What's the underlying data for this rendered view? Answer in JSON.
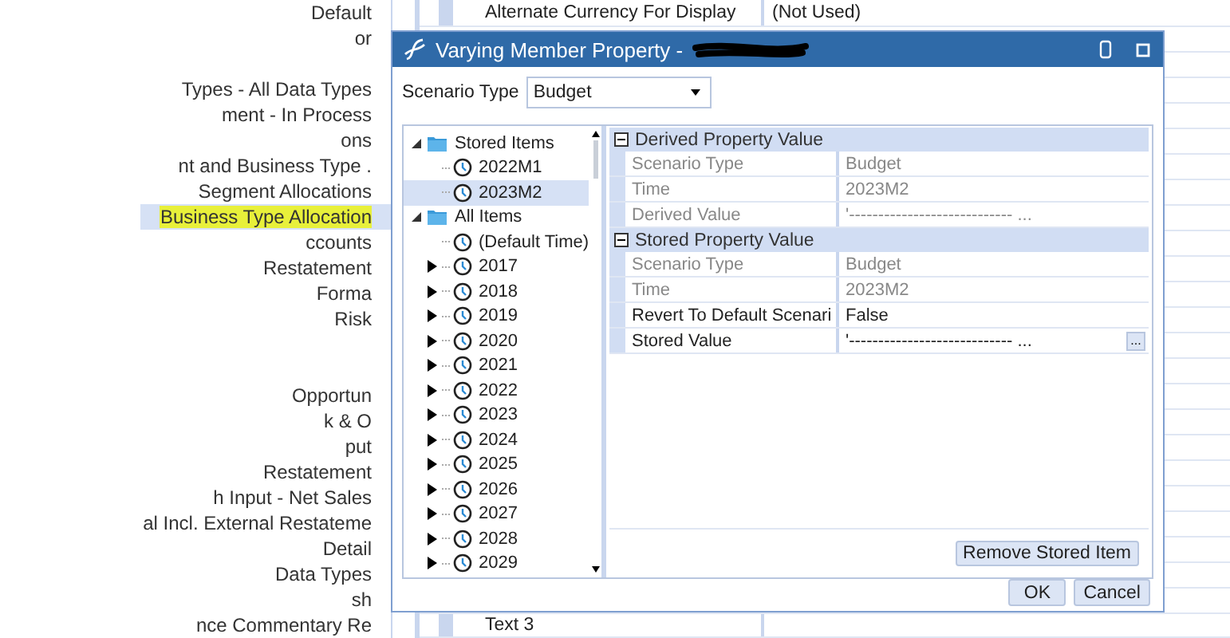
{
  "background_tree": {
    "rows": [
      {
        "text": "Default",
        "selected": false
      },
      {
        "text": "or",
        "selected": false
      },
      {
        "selected": false
      },
      {
        "text": "Types - All Data Types",
        "selected": false
      },
      {
        "text": "ment - In Process",
        "selected": false
      },
      {
        "text": "ons",
        "selected": false
      },
      {
        "text": "nt and Business Type .",
        "selected": false
      },
      {
        "text": "Segment Allocations",
        "selected": false
      },
      {
        "text": "Business Type Allocation",
        "selected": true
      },
      {
        "text": "ccounts",
        "selected": false
      },
      {
        "text": "Restatement",
        "selected": false
      },
      {
        "text": "Forma",
        "selected": false
      },
      {
        "text": "Risk",
        "selected": false
      },
      {
        "selected": false
      },
      {
        "selected": false
      },
      {
        "text": "Opportun",
        "selected": false
      },
      {
        "text": "k & O",
        "selected": false
      },
      {
        "text": "put",
        "selected": false
      },
      {
        "text": "Restatement",
        "selected": false
      },
      {
        "text": "h Input - Net Sales",
        "selected": false
      },
      {
        "text": "al Incl. External Restateme",
        "selected": false
      },
      {
        "text": "Detail",
        "selected": false
      },
      {
        "text": "Data Types",
        "selected": false
      },
      {
        "text": "sh",
        "selected": false
      },
      {
        "text": "nce Commentary Re",
        "selected": false
      }
    ]
  },
  "background_grid": {
    "first_row": {
      "label": "Alternate Currency For Display",
      "value": "(Not Used)"
    },
    "last_row": {
      "label": "Text 3"
    }
  },
  "dialog": {
    "title": "Varying Member Property -",
    "scenario_type": {
      "label": "Scenario Type",
      "value": "Budget"
    },
    "tree": [
      {
        "label": "Stored Items",
        "kind": "folder",
        "expanded": true,
        "children": [
          {
            "label": "2022M1",
            "kind": "point",
            "selected": false
          },
          {
            "label": "2023M2",
            "kind": "point",
            "selected": true
          }
        ]
      },
      {
        "label": "All Items",
        "kind": "folder",
        "expanded": true,
        "children": [
          {
            "label": "(Default Time)",
            "kind": "point",
            "selected": false
          },
          {
            "label": "2017",
            "kind": "period",
            "expanded": false,
            "selected": false
          },
          {
            "label": "2018",
            "kind": "period",
            "expanded": false,
            "selected": false
          },
          {
            "label": "2019",
            "kind": "period",
            "expanded": false,
            "selected": false
          },
          {
            "label": "2020",
            "kind": "period",
            "expanded": false,
            "selected": false
          },
          {
            "label": "2021",
            "kind": "period",
            "expanded": false,
            "selected": false
          },
          {
            "label": "2022",
            "kind": "period",
            "expanded": false,
            "selected": false
          },
          {
            "label": "2023",
            "kind": "period",
            "expanded": false,
            "selected": false
          },
          {
            "label": "2024",
            "kind": "period",
            "expanded": false,
            "selected": false
          },
          {
            "label": "2025",
            "kind": "period",
            "expanded": false,
            "selected": false
          },
          {
            "label": "2026",
            "kind": "period",
            "expanded": false,
            "selected": false
          },
          {
            "label": "2027",
            "kind": "period",
            "expanded": false,
            "selected": false
          },
          {
            "label": "2028",
            "kind": "period",
            "expanded": false,
            "selected": false
          },
          {
            "label": "2029",
            "kind": "period",
            "expanded": false,
            "selected": false
          }
        ]
      }
    ],
    "properties": [
      {
        "category": "Derived Property Value",
        "expanded": true,
        "rows": [
          {
            "name": "Scenario Type",
            "value": "Budget",
            "disabled": true
          },
          {
            "name": "Time",
            "value": "2023M2",
            "disabled": true
          },
          {
            "name": "Derived Value",
            "value": "'---------------------------- ...",
            "disabled": true
          }
        ]
      },
      {
        "category": "Stored Property Value",
        "expanded": true,
        "rows": [
          {
            "name": "Scenario Type",
            "value": "Budget",
            "disabled": true
          },
          {
            "name": "Time",
            "value": "2023M2",
            "disabled": true
          },
          {
            "name": "Revert To Default Scenari",
            "value": "False",
            "disabled": false
          },
          {
            "name": "Stored Value",
            "value": "'---------------------------- ...",
            "disabled": false,
            "kind": "button",
            "button_label": "..."
          }
        ]
      }
    ],
    "remove_button": "Remove Stored Item",
    "buttons": [
      "OK",
      "Cancel"
    ]
  }
}
